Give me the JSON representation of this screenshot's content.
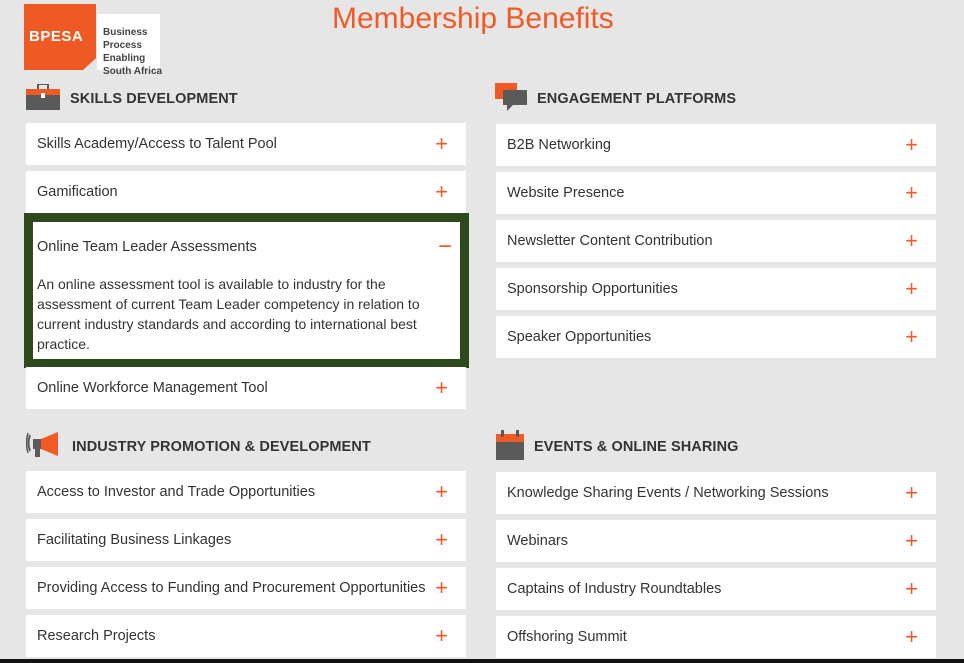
{
  "logo": {
    "brand": "BPESA",
    "tagline": [
      "Business Process",
      "Enabling",
      "South Africa"
    ]
  },
  "page_title": "Membership Benefits",
  "colors": {
    "accent": "#f15a24",
    "highlight_border": "#2e4a1c",
    "background": "#e6e6e6"
  },
  "sections": {
    "skills": {
      "icon": "briefcase-icon",
      "title": "SKILLS DEVELOPMENT",
      "items": [
        {
          "label": "Skills Academy/Access to Talent Pool",
          "sign": "+"
        },
        {
          "label": "Gamification",
          "sign": "+"
        },
        {
          "label": "Online Team Leader Assessments",
          "sign": "−",
          "expanded": true,
          "body": "An online assessment tool is available to industry for the assessment of current Team Leader competency in relation to current industry standards and according to international best practice."
        },
        {
          "label": "Online Workforce Management Tool",
          "sign": "+"
        }
      ]
    },
    "engagement": {
      "icon": "chat-bubbles-icon",
      "title": "ENGAGEMENT PLATFORMS",
      "items": [
        {
          "label": "B2B Networking",
          "sign": "+"
        },
        {
          "label": "Website Presence",
          "sign": "+"
        },
        {
          "label": "Newsletter Content Contribution",
          "sign": "+"
        },
        {
          "label": "Sponsorship Opportunities",
          "sign": "+"
        },
        {
          "label": "Speaker Opportunities",
          "sign": "+"
        }
      ]
    },
    "industry": {
      "icon": "megaphone-icon",
      "title": "INDUSTRY PROMOTION & DEVELOPMENT",
      "items": [
        {
          "label": "Access to Investor and Trade Opportunities",
          "sign": "+"
        },
        {
          "label": "Facilitating Business Linkages",
          "sign": "+"
        },
        {
          "label": "Providing Access to Funding and Procurement Opportunities",
          "sign": "+"
        },
        {
          "label": "Research Projects",
          "sign": "+"
        }
      ]
    },
    "events": {
      "icon": "calendar-icon",
      "title": "EVENTS & ONLINE SHARING",
      "items": [
        {
          "label": "Knowledge Sharing Events / Networking Sessions",
          "sign": "+"
        },
        {
          "label": "Webinars",
          "sign": "+"
        },
        {
          "label": "Captains of Industry Roundtables",
          "sign": "+"
        },
        {
          "label": "Offshoring Summit",
          "sign": "+"
        }
      ]
    }
  }
}
